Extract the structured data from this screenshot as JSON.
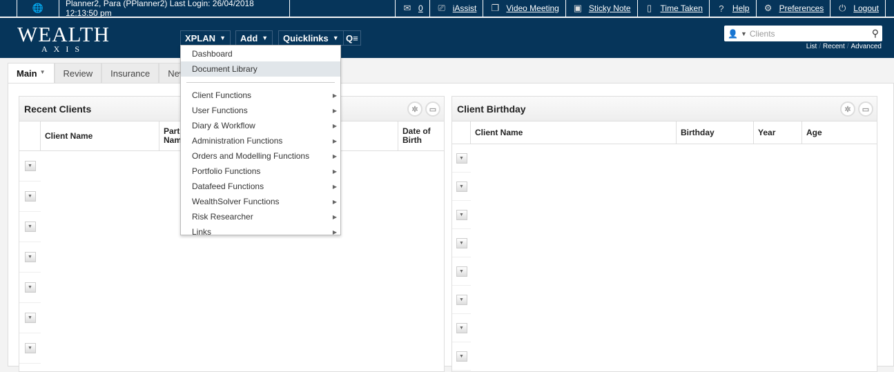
{
  "topbar": {
    "user_info": "Planner2, Para (PPlanner2) Last Login: 26/04/2018 12:13:50 pm",
    "messages_count": "0",
    "iassist": "iAssist",
    "video_meeting": "Video Meeting",
    "sticky_note": "Sticky Note",
    "time_taken": "Time Taken",
    "help": "Help",
    "preferences": "Preferences",
    "logout": "Logout"
  },
  "logo": {
    "line1": "WEALTH",
    "line2": "AXIS"
  },
  "nav": {
    "xplan": "XPLAN",
    "add": "Add",
    "quicklinks": "Quicklinks"
  },
  "search": {
    "placeholder": "Clients",
    "links": [
      "List",
      "Recent",
      "Advanced"
    ]
  },
  "tabs": [
    "Main",
    "Review",
    "Insurance",
    "New"
  ],
  "menu": {
    "items": [
      "Dashboard",
      "Document Library"
    ],
    "submenus": [
      "Client Functions",
      "User Functions",
      "Diary & Workflow",
      "Administration Functions",
      "Orders and Modelling Functions",
      "Portfolio Functions",
      "Datafeed Functions",
      "WealthSolver Functions",
      "Risk Researcher",
      "Links"
    ],
    "highlighted": "Document Library"
  },
  "recent_clients": {
    "title": "Recent Clients",
    "columns": [
      "Client Name",
      "Partner Name",
      "Date of Birth"
    ]
  },
  "client_birthday": {
    "title": "Client Birthday",
    "columns": [
      "Client Name",
      "Birthday",
      "Year",
      "Age"
    ]
  },
  "colors": {
    "brand": "#06355a",
    "menu_highlight": "#e1e6ea"
  }
}
